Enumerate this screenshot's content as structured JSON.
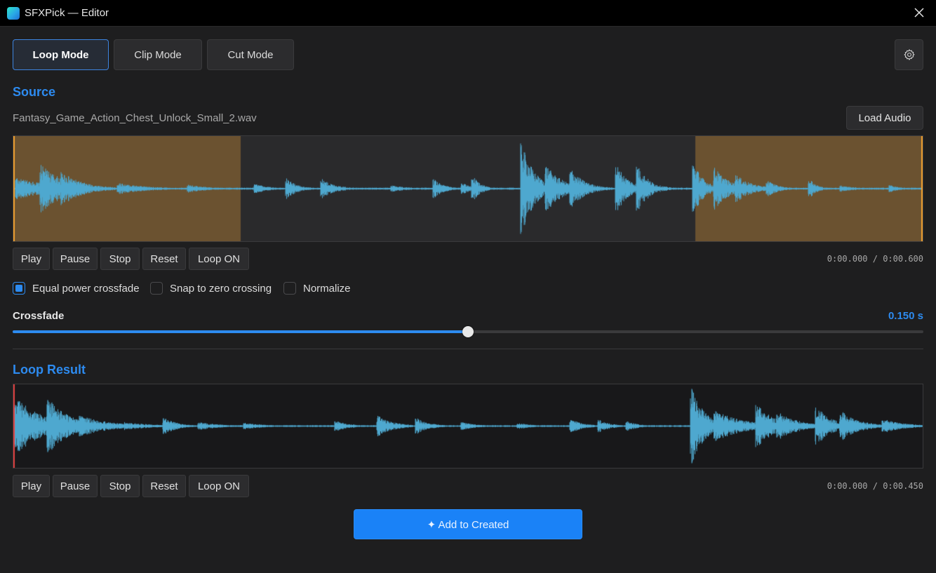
{
  "window": {
    "title": "SFXPick — Editor"
  },
  "modes": [
    {
      "label": "Loop Mode",
      "active": true
    },
    {
      "label": "Clip Mode",
      "active": false
    },
    {
      "label": "Cut Mode",
      "active": false
    }
  ],
  "source": {
    "title": "Source",
    "filename": "Fantasy_Game_Action_Chest_Unlock_Small_2.wav",
    "load_label": "Load Audio",
    "time": "0:00.000 / 0:00.600",
    "loop_region": {
      "start_s": 0.15,
      "end_s": 0.45
    },
    "duration_s": 0.6
  },
  "controls": {
    "play": "Play",
    "pause": "Pause",
    "stop": "Stop",
    "reset": "Reset",
    "loop": "Loop ON"
  },
  "options": {
    "equal_power": {
      "label": "Equal power crossfade",
      "checked": true
    },
    "snap_zero": {
      "label": "Snap to zero crossing",
      "checked": false
    },
    "normalize": {
      "label": "Normalize",
      "checked": false
    }
  },
  "crossfade": {
    "label": "Crossfade",
    "value_label": "0.150 s",
    "value": 0.5
  },
  "result": {
    "title": "Loop Result",
    "time": "0:00.000 / 0:00.450"
  },
  "add_button": "✦ Add to Created",
  "colors": {
    "accent": "#2d8bf0",
    "waveform": "#4fa8cf",
    "crossfade_region": "#6b5230",
    "loop_marker": "#f0a030",
    "playhead": "#e04040"
  },
  "icons": {
    "close": "close-icon",
    "settings": "gear-icon",
    "app": "app-icon"
  }
}
